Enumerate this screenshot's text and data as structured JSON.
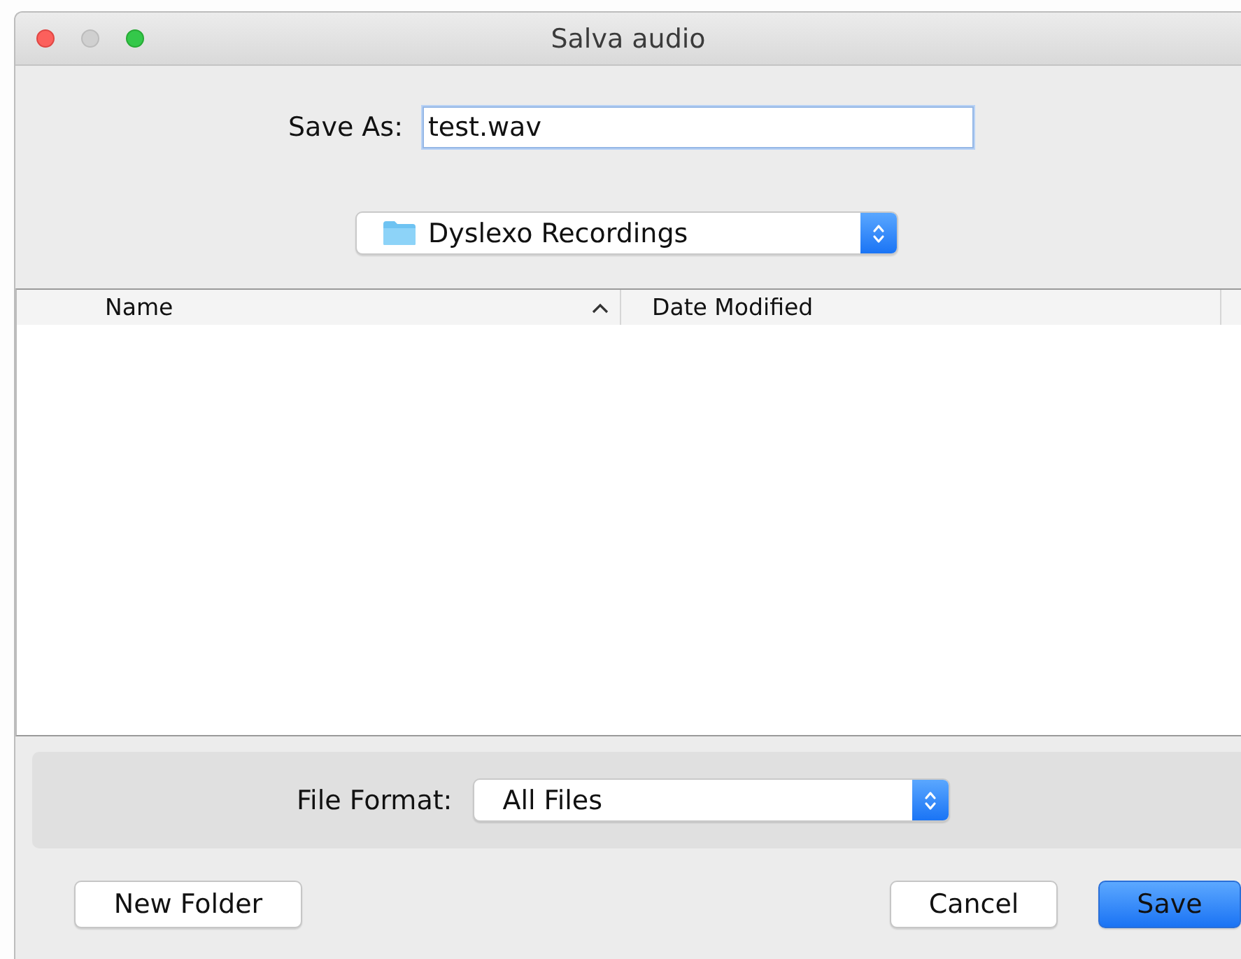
{
  "window": {
    "title": "Salva audio",
    "controls": [
      {
        "kind": "close",
        "enabled": true
      },
      {
        "kind": "minimize",
        "enabled": false
      },
      {
        "kind": "zoom",
        "enabled": true
      }
    ]
  },
  "save_as": {
    "label": "Save As:",
    "value": "test.wav"
  },
  "location": {
    "value": "Dyslexo Recordings"
  },
  "table": {
    "columns": [
      {
        "label": "Name",
        "sorted": true
      },
      {
        "label": "Date Modified",
        "sorted": false
      }
    ]
  },
  "file_format": {
    "label": "File Format:",
    "value": "All Files"
  },
  "buttons": [
    {
      "label": "New Folder",
      "kind": "normal"
    },
    {
      "label": "Cancel",
      "kind": "normal"
    },
    {
      "label": "Save",
      "kind": "default"
    }
  ]
}
